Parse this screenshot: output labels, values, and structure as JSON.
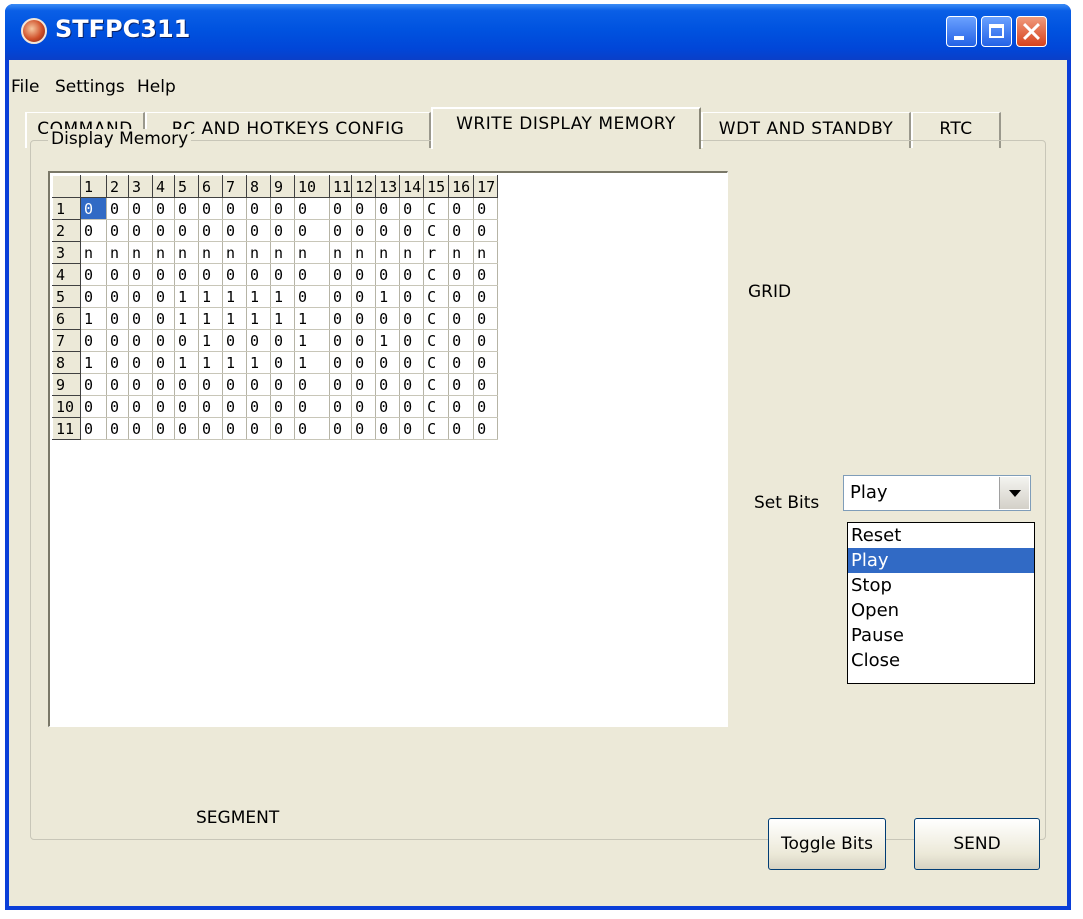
{
  "window": {
    "title": "STFPC311"
  },
  "menu": [
    "File",
    "Settings",
    "Help"
  ],
  "tabs": [
    "COMMAND",
    "RC AND HOTKEYS CONFIG",
    "WRITE DISPLAY MEMORY",
    "WDT AND STANDBY",
    "RTC"
  ],
  "active_tab": "WRITE DISPLAY MEMORY",
  "group": {
    "label": "Display Memory"
  },
  "grid": {
    "column_headers": [
      "1",
      "2",
      "3",
      "4",
      "5",
      "6",
      "7",
      "8",
      "9",
      "10",
      "11",
      "12",
      "13",
      "14",
      "15",
      "16",
      "17"
    ],
    "row_headers": [
      "1",
      "2",
      "3",
      "4",
      "5",
      "6",
      "7",
      "8",
      "9",
      "10",
      "11"
    ],
    "selected_cell": {
      "row": 1,
      "column": 1
    },
    "rows": [
      [
        "0",
        "0",
        "0",
        "0",
        "0",
        "0",
        "0",
        "0",
        "0",
        "0",
        "0",
        "0",
        "0",
        "0",
        "C",
        "0",
        "0"
      ],
      [
        "0",
        "0",
        "0",
        "0",
        "0",
        "0",
        "0",
        "0",
        "0",
        "0",
        "0",
        "0",
        "0",
        "0",
        "C",
        "0",
        "0"
      ],
      [
        "n",
        "n",
        "n",
        "n",
        "n",
        "n",
        "n",
        "n",
        "n",
        "n",
        "n",
        "n",
        "n",
        "n",
        "r",
        "n",
        "n"
      ],
      [
        "0",
        "0",
        "0",
        "0",
        "0",
        "0",
        "0",
        "0",
        "0",
        "0",
        "0",
        "0",
        "0",
        "0",
        "C",
        "0",
        "0"
      ],
      [
        "0",
        "0",
        "0",
        "0",
        "1",
        "1",
        "1",
        "1",
        "1",
        "0",
        "0",
        "0",
        "1",
        "0",
        "C",
        "0",
        "0"
      ],
      [
        "1",
        "0",
        "0",
        "0",
        "1",
        "1",
        "1",
        "1",
        "1",
        "1",
        "0",
        "0",
        "0",
        "0",
        "C",
        "0",
        "0"
      ],
      [
        "0",
        "0",
        "0",
        "0",
        "0",
        "1",
        "0",
        "0",
        "0",
        "1",
        "0",
        "0",
        "1",
        "0",
        "C",
        "0",
        "0"
      ],
      [
        "1",
        "0",
        "0",
        "0",
        "1",
        "1",
        "1",
        "1",
        "0",
        "1",
        "0",
        "0",
        "0",
        "0",
        "C",
        "0",
        "0"
      ],
      [
        "0",
        "0",
        "0",
        "0",
        "0",
        "0",
        "0",
        "0",
        "0",
        "0",
        "0",
        "0",
        "0",
        "0",
        "C",
        "0",
        "0"
      ],
      [
        "0",
        "0",
        "0",
        "0",
        "0",
        "0",
        "0",
        "0",
        "0",
        "0",
        "0",
        "0",
        "0",
        "0",
        "C",
        "0",
        "0"
      ],
      [
        "0",
        "0",
        "0",
        "0",
        "0",
        "0",
        "0",
        "0",
        "0",
        "0",
        "0",
        "0",
        "0",
        "0",
        "C",
        "0",
        "0"
      ]
    ]
  },
  "labels": {
    "grid": "GRID",
    "segment": "SEGMENT",
    "set_bits": "Set Bits"
  },
  "set_bits_select": {
    "value": "Play",
    "options": [
      "Reset",
      "Play",
      "Stop",
      "Open",
      "Pause",
      "Close"
    ],
    "highlighted": "Play"
  },
  "buttons": {
    "toggle_bits": "Toggle Bits",
    "send": "SEND"
  },
  "colors": {
    "selection": "#316ac5",
    "titlebar": "#0053e0",
    "face": "#ece9d8"
  }
}
